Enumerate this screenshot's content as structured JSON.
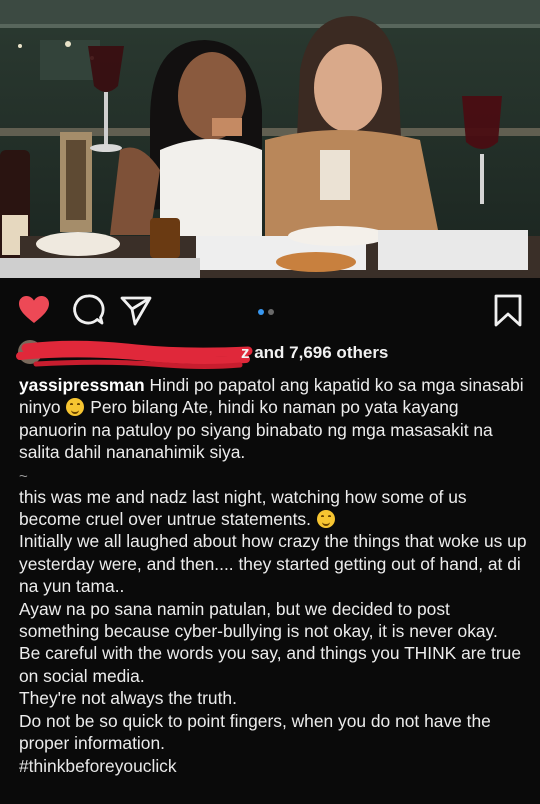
{
  "post": {
    "likes": {
      "suffix": "z and 7,696 others"
    },
    "caption": {
      "username": "yassipressman",
      "para1_a": " Hindi po papatol ang kapatid ko sa mga sinasabi ninyo ",
      "para1_b": " Pero bilang Ate, hindi ko naman po yata kayang panuorin na patuloy po siyang binabato ng mga masasakit na salita dahil nananahimik siya.",
      "separator": "~",
      "para2_a": "this was me and nadz last night, watching how some of us become cruel over untrue statements. ",
      "para3": "Initially we all laughed about how crazy the things that woke us up yesterday were, and then.... they started getting out of hand, at di na yun tama..",
      "para4": "Ayaw na po sana namin patulan, but we decided to post something because cyber-bullying is not okay, it is never okay.",
      "para5": "Be careful with the words you say, and things you THINK are true on social media.",
      "para6": "They're not always the truth.",
      "para7": "Do not be so quick to point fingers, when you do not have the proper information.",
      "hashtag": "#thinkbeforeyouclick"
    },
    "carousel": {
      "total": 2,
      "active": 2
    },
    "icons": {
      "like": "heart-filled-icon",
      "comment": "comment-bubble-icon",
      "share": "paper-plane-icon",
      "save": "bookmark-icon"
    },
    "colors": {
      "like": "#ed4956",
      "dot_active": "#3897f0",
      "dot_inactive": "#6a6a6a",
      "redaction": "#e0283a"
    }
  }
}
